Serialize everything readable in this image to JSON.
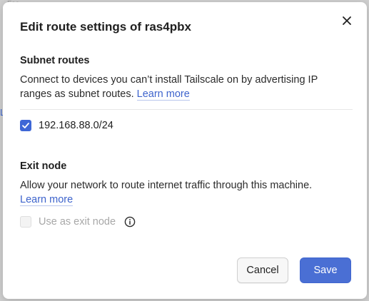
{
  "background": {
    "fragment_top": "Fae",
    "fragment_left": "L"
  },
  "dialog": {
    "title": "Edit route settings of ras4pbx",
    "close_icon": "close-icon"
  },
  "subnet": {
    "heading": "Subnet routes",
    "description": "Connect to devices you can’t install Tailscale on by advertising IP ranges as subnet routes.",
    "learn_more": "Learn more",
    "routes": [
      {
        "label": "192.168.88.0/24",
        "checked": true
      }
    ]
  },
  "exit_node": {
    "heading": "Exit node",
    "description": "Allow your network to route internet traffic through this machine.",
    "learn_more": "Learn more",
    "checkbox_label": "Use as exit node",
    "checked": false,
    "disabled": true,
    "info_icon": "info-icon"
  },
  "buttons": {
    "cancel": "Cancel",
    "save": "Save"
  },
  "colors": {
    "accent": "#3e67d6",
    "save_bg": "#4a6fd4",
    "link": "#3d63cc"
  }
}
